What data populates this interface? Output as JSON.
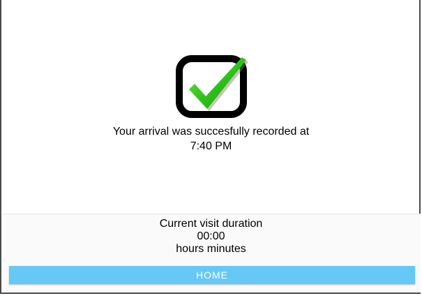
{
  "confirmation": {
    "icon": "checkbox-checked-icon",
    "message_line1": "Your arrival was succesfully recorded at",
    "time": "7:40 PM"
  },
  "visit": {
    "label": "Current visit duration",
    "value": "00:00",
    "units": "hours minutes"
  },
  "home_button": {
    "label": "HOME"
  },
  "colors": {
    "check_green": "#2ec41a",
    "box_black": "#000000",
    "button_blue": "#66c8f7"
  }
}
